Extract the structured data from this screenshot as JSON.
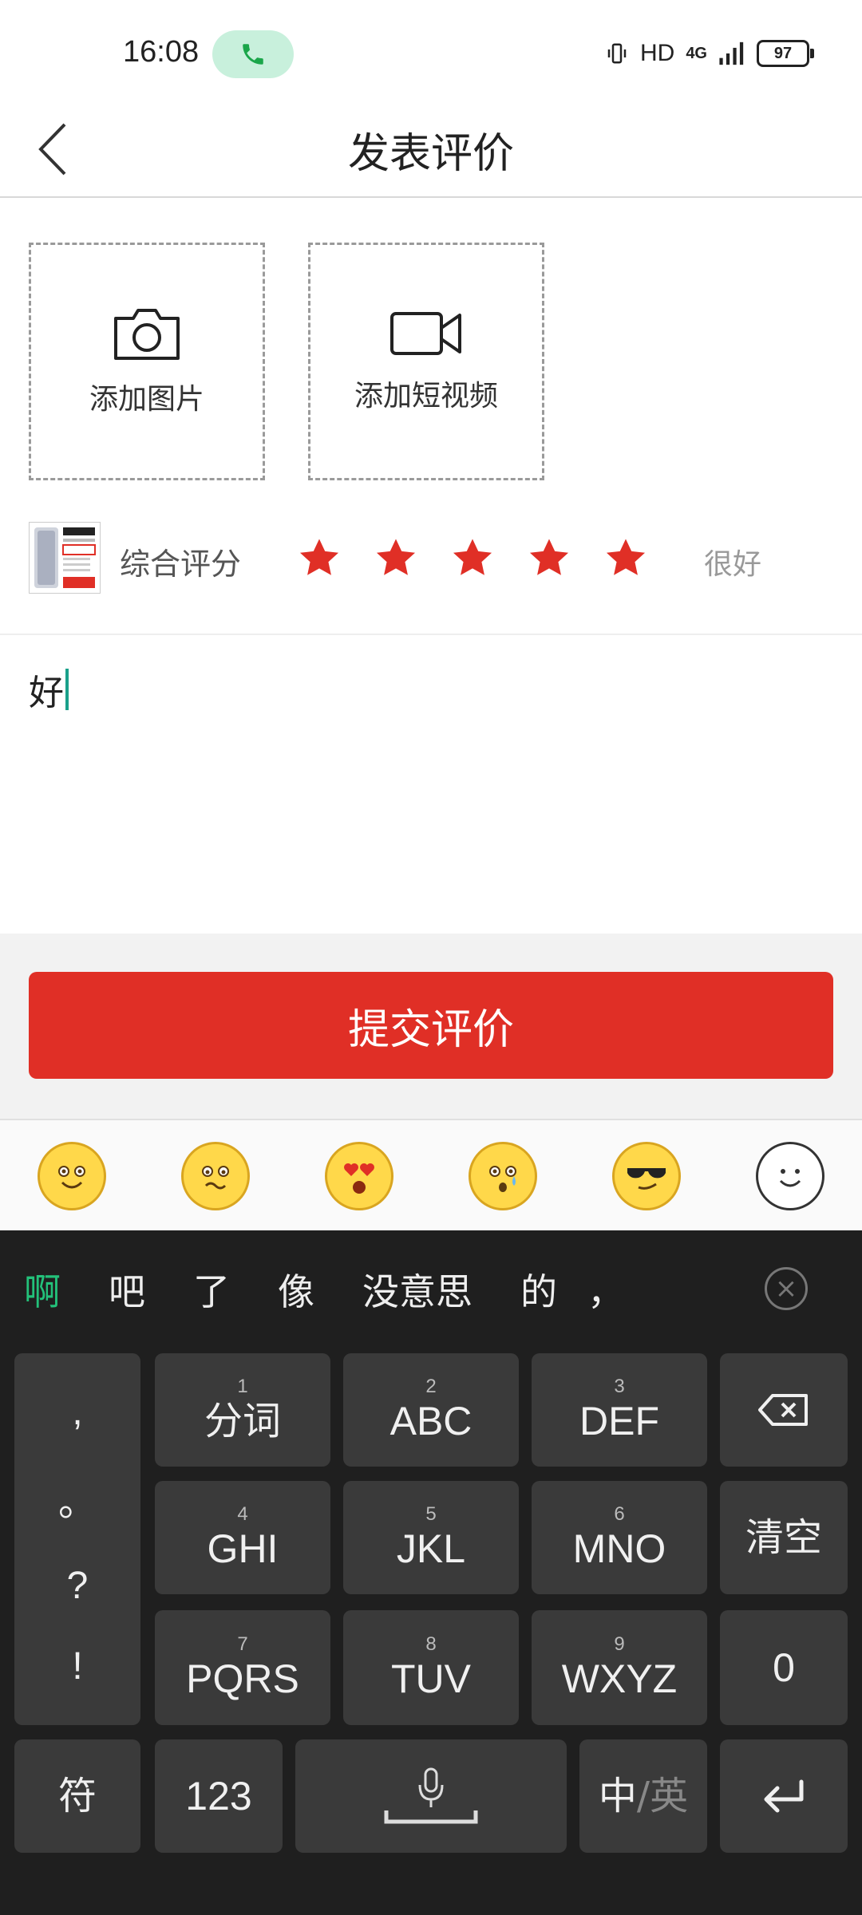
{
  "status_bar": {
    "time": "16:08",
    "hd": "HD",
    "network": "4G",
    "battery": "97"
  },
  "header": {
    "title": "发表评价"
  },
  "upload": {
    "photo_label": "添加图片",
    "video_label": "添加短视频"
  },
  "rating": {
    "label": "综合评分",
    "stars": 5,
    "max_stars": 5,
    "text": "很好",
    "star_color": "#e02f26"
  },
  "review": {
    "text": "好"
  },
  "submit": {
    "label": "提交评价",
    "color": "#e02f26"
  },
  "emoji_bar": {
    "items": [
      "smile-emoji",
      "woozy-emoji",
      "heart-eyes-emoji",
      "crying-emoji",
      "cool-emoji",
      "emoji-panel-icon"
    ]
  },
  "keyboard": {
    "candidates": [
      "啊",
      "吧",
      "了",
      "像",
      "没意思",
      "的",
      "，"
    ],
    "punct": [
      ",",
      "。",
      "?",
      "!"
    ],
    "keys": [
      {
        "num": "1",
        "label": "分词"
      },
      {
        "num": "2",
        "label": "ABC"
      },
      {
        "num": "3",
        "label": "DEF"
      },
      {
        "num": "4",
        "label": "GHI"
      },
      {
        "num": "5",
        "label": "JKL"
      },
      {
        "num": "6",
        "label": "MNO"
      },
      {
        "num": "7",
        "label": "PQRS"
      },
      {
        "num": "8",
        "label": "TUV"
      },
      {
        "num": "9",
        "label": "WXYZ"
      }
    ],
    "clear_label": "清空",
    "zero_label": "0",
    "symbol_label": "符",
    "num_label": "123",
    "lang_cn": "中",
    "lang_en": "/英"
  }
}
